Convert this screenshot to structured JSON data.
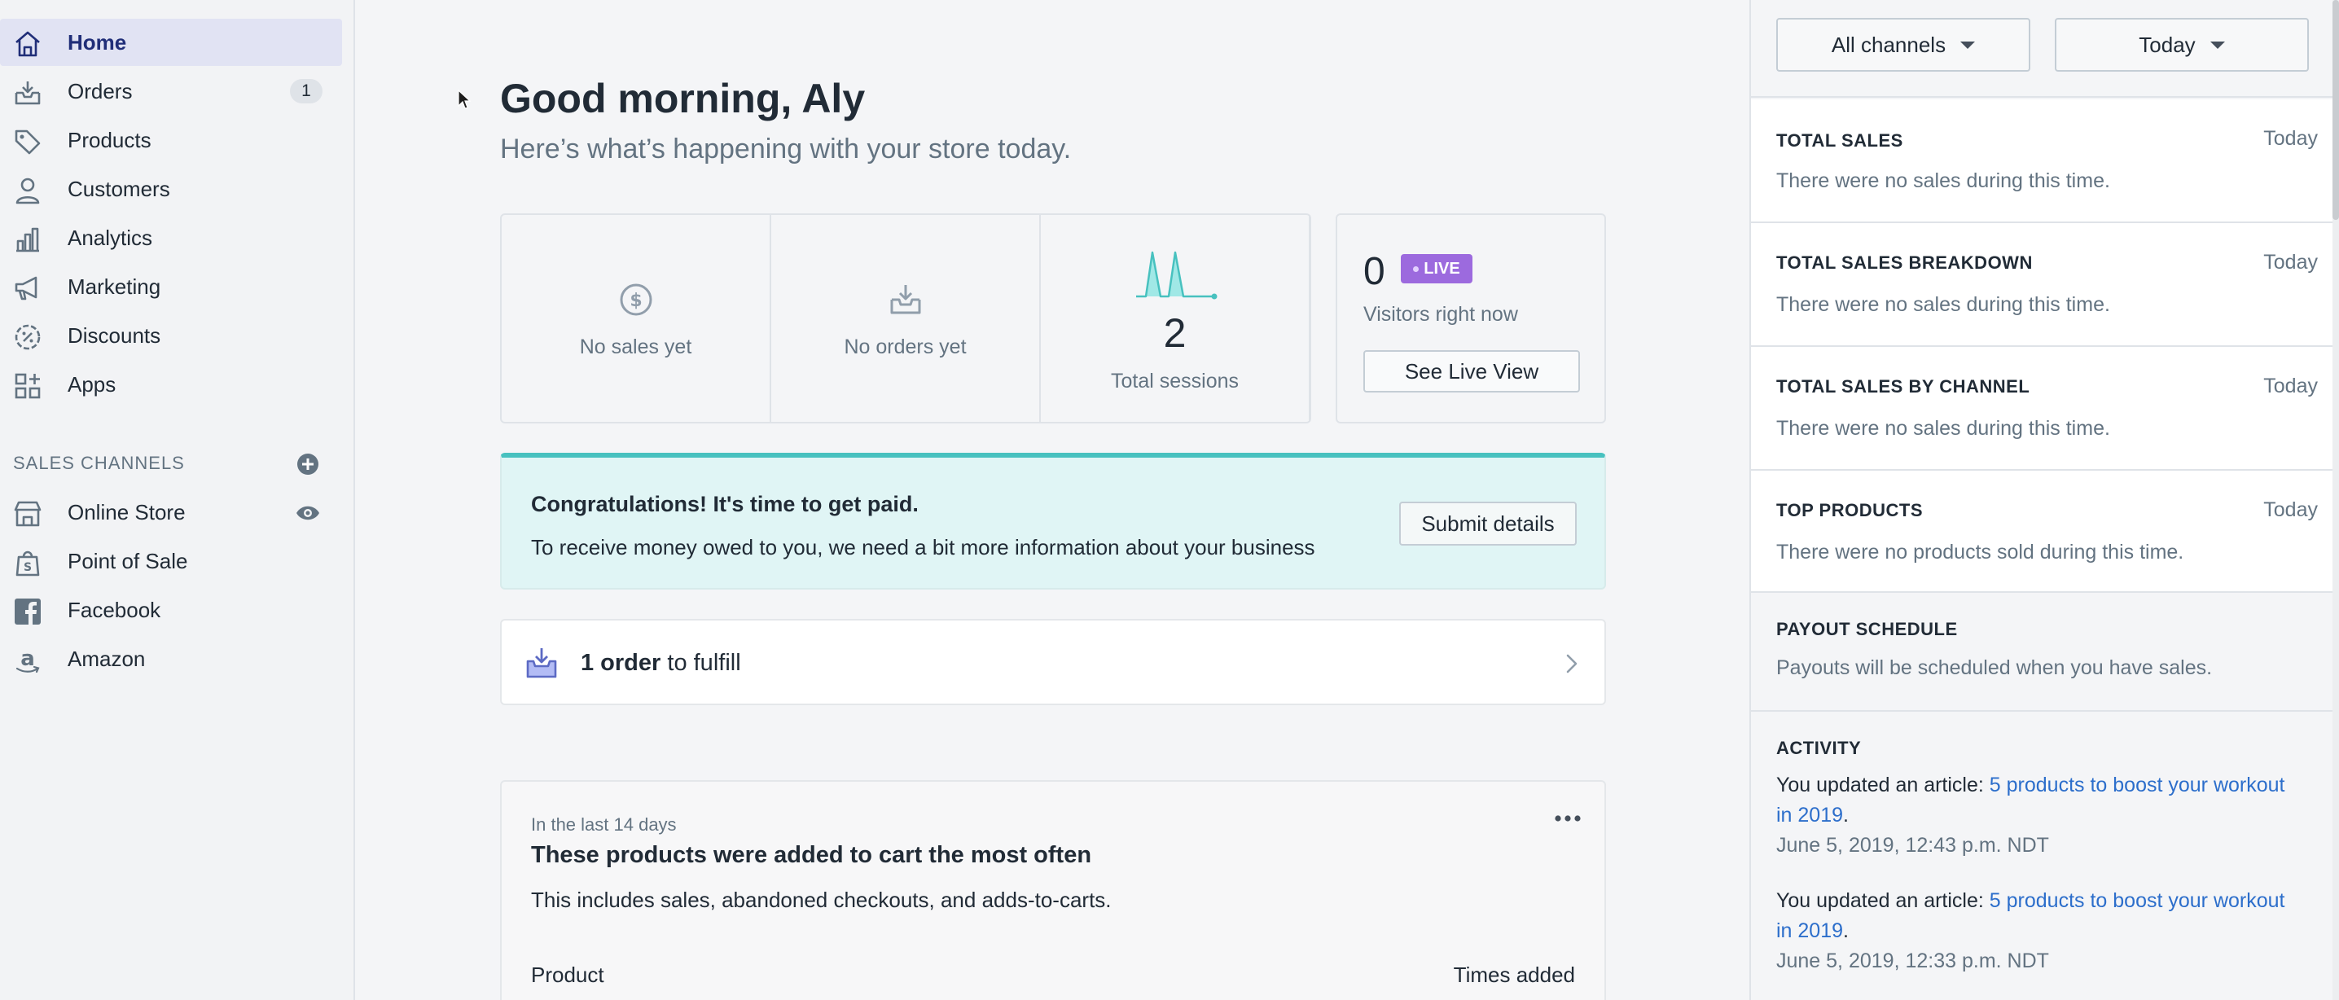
{
  "sidebar": {
    "items": [
      {
        "label": "Home",
        "icon": "home-icon"
      },
      {
        "label": "Orders",
        "icon": "orders-icon",
        "badge": "1"
      },
      {
        "label": "Products",
        "icon": "tag-icon"
      },
      {
        "label": "Customers",
        "icon": "person-icon"
      },
      {
        "label": "Analytics",
        "icon": "bar-chart-icon"
      },
      {
        "label": "Marketing",
        "icon": "megaphone-icon"
      },
      {
        "label": "Discounts",
        "icon": "discount-icon"
      },
      {
        "label": "Apps",
        "icon": "apps-icon"
      }
    ],
    "channels_heading": "SALES CHANNELS",
    "channels": [
      {
        "label": "Online Store",
        "icon": "store-icon"
      },
      {
        "label": "Point of Sale",
        "icon": "pos-bag-icon"
      },
      {
        "label": "Facebook",
        "icon": "facebook-icon"
      },
      {
        "label": "Amazon",
        "icon": "amazon-icon"
      }
    ]
  },
  "main": {
    "greeting": "Good morning, Aly",
    "subtitle": "Here’s what’s happening with your store today.",
    "stats": {
      "sales_label": "No sales yet",
      "orders_label": "No orders yet",
      "sessions_value": "2",
      "sessions_label": "Total sessions"
    },
    "live": {
      "count": "0",
      "badge": "LIVE",
      "label": "Visitors right now",
      "button": "See Live View"
    },
    "payment_banner": {
      "title": "Congratulations! It's time to get paid.",
      "text": "To receive money owed to you, we need a bit more information about your business",
      "button": "Submit details"
    },
    "fulfill": {
      "count": "1 order",
      "suffix": " to fulfill"
    },
    "cart_card": {
      "kicker": "In the last 14 days",
      "title": "These products were added to cart the most often",
      "description": "This includes sales, abandoned checkouts, and adds-to-carts.",
      "col_product": "Product",
      "col_times": "Times added"
    }
  },
  "right_panel": {
    "channel_select": "All channels",
    "date_select": "Today",
    "cards": [
      {
        "heading": "TOTAL SALES",
        "when": "Today",
        "body": "There were no sales during this time."
      },
      {
        "heading": "TOTAL SALES BREAKDOWN",
        "when": "Today",
        "body": "There were no sales during this time."
      },
      {
        "heading": "TOTAL SALES BY CHANNEL",
        "when": "Today",
        "body": "There were no sales during this time."
      },
      {
        "heading": "TOP PRODUCTS",
        "when": "Today",
        "body": "There were no products sold during this time."
      }
    ],
    "payout": {
      "heading": "PAYOUT SCHEDULE",
      "body": "Payouts will be scheduled when you have sales."
    },
    "activity": {
      "heading": "ACTIVITY",
      "entries": [
        {
          "prefix": "You updated an article: ",
          "link": "5 products to boost your workout in 2019",
          "suffix": ".",
          "date": "June 5, 2019, 12:43 p.m. NDT"
        },
        {
          "prefix": "You updated an article: ",
          "link": "5 products to boost your workout in 2019",
          "suffix": ".",
          "date": "June 5, 2019, 12:33 p.m. NDT"
        }
      ]
    }
  },
  "colors": {
    "accent_active": "#202e78",
    "active_bg": "#e1e3f3",
    "live_badge": "#9c6ade",
    "teal": "#47c1bf",
    "link": "#2c6ecb"
  }
}
